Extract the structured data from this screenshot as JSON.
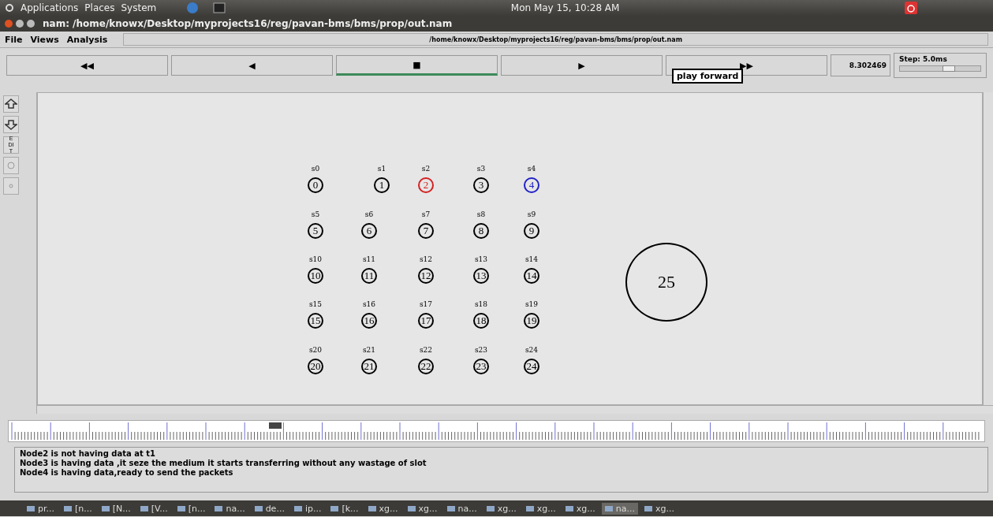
{
  "top_panel": {
    "menus": [
      "Applications",
      "Places",
      "System"
    ],
    "clock": "Mon May 15, 10:28 AM"
  },
  "window": {
    "title": "nam: /home/knowx/Desktop/myprojects16/reg/pavan-bms/bms/prop/out.nam"
  },
  "menu_bar": {
    "items": [
      "File",
      "Views",
      "Analysis"
    ],
    "path": "/home/knowx/Desktop/myprojects16/reg/pavan-bms/bms/prop/out.nam"
  },
  "controls": [
    {
      "label": "◀◀",
      "selected": false
    },
    {
      "label": "◀",
      "selected": false
    },
    {
      "label": "■",
      "selected": true
    },
    {
      "label": "▶",
      "selected": false
    },
    {
      "label": "▶▶",
      "selected": false
    }
  ],
  "tooltip": "play forward",
  "sim_time": "8.302469",
  "step": {
    "label": "Step: 5.0ms",
    "level": 0.6
  },
  "side_tools": [
    {
      "kind": "zoom-in"
    },
    {
      "kind": "zoom-out"
    },
    {
      "kind": "edit",
      "label": "EDIT"
    },
    {
      "kind": "circle"
    },
    {
      "kind": "dot"
    }
  ],
  "nodes": [
    {
      "label": "s0",
      "id": "0",
      "color": "#000000"
    },
    {
      "label": "s1",
      "id": "1",
      "color": "#000000"
    },
    {
      "label": "s2",
      "id": "2",
      "color": "#d42020"
    },
    {
      "label": "s3",
      "id": "3",
      "color": "#000000"
    },
    {
      "label": "s4",
      "id": "4",
      "color": "#2020c8"
    },
    {
      "label": "s5",
      "id": "5",
      "color": "#000000"
    },
    {
      "label": "s6",
      "id": "6",
      "color": "#000000"
    },
    {
      "label": "s7",
      "id": "7",
      "color": "#000000"
    },
    {
      "label": "s8",
      "id": "8",
      "color": "#000000"
    },
    {
      "label": "s9",
      "id": "9",
      "color": "#000000"
    },
    {
      "label": "s10",
      "id": "10",
      "color": "#000000"
    },
    {
      "label": "s11",
      "id": "11",
      "color": "#000000"
    },
    {
      "label": "s12",
      "id": "12",
      "color": "#000000"
    },
    {
      "label": "s13",
      "id": "13",
      "color": "#000000"
    },
    {
      "label": "s14",
      "id": "14",
      "color": "#000000"
    },
    {
      "label": "s15",
      "id": "15",
      "color": "#000000"
    },
    {
      "label": "s16",
      "id": "16",
      "color": "#000000"
    },
    {
      "label": "s17",
      "id": "17",
      "color": "#000000"
    },
    {
      "label": "s18",
      "id": "18",
      "color": "#000000"
    },
    {
      "label": "s19",
      "id": "19",
      "color": "#000000"
    },
    {
      "label": "s20",
      "id": "20",
      "color": "#000000"
    },
    {
      "label": "s21",
      "id": "21",
      "color": "#000000"
    },
    {
      "label": "s22",
      "id": "22",
      "color": "#000000"
    },
    {
      "label": "s23",
      "id": "23",
      "color": "#000000"
    },
    {
      "label": "s24",
      "id": "24",
      "color": "#000000"
    }
  ],
  "big_node": "25",
  "annotations": [
    "Node2 is not having data at t1",
    "Node3 is having data ,it seze the medium it starts transferring without any wastage of slot",
    "Node4 is having data,ready to send the packets"
  ],
  "taskbar": [
    {
      "label": "pr...",
      "selected": false
    },
    {
      "label": "[n...",
      "selected": false
    },
    {
      "label": "[N...",
      "selected": false
    },
    {
      "label": "[V...",
      "selected": false
    },
    {
      "label": "[n...",
      "selected": false
    },
    {
      "label": "na...",
      "selected": false
    },
    {
      "label": "de...",
      "selected": false
    },
    {
      "label": "ip...",
      "selected": false
    },
    {
      "label": "[k...",
      "selected": false
    },
    {
      "label": "xg...",
      "selected": false
    },
    {
      "label": "xg...",
      "selected": false
    },
    {
      "label": "na...",
      "selected": false
    },
    {
      "label": "xg...",
      "selected": false
    },
    {
      "label": "xg...",
      "selected": false
    },
    {
      "label": "xg...",
      "selected": false
    },
    {
      "label": "na...",
      "selected": true
    },
    {
      "label": "xg...",
      "selected": false
    }
  ]
}
